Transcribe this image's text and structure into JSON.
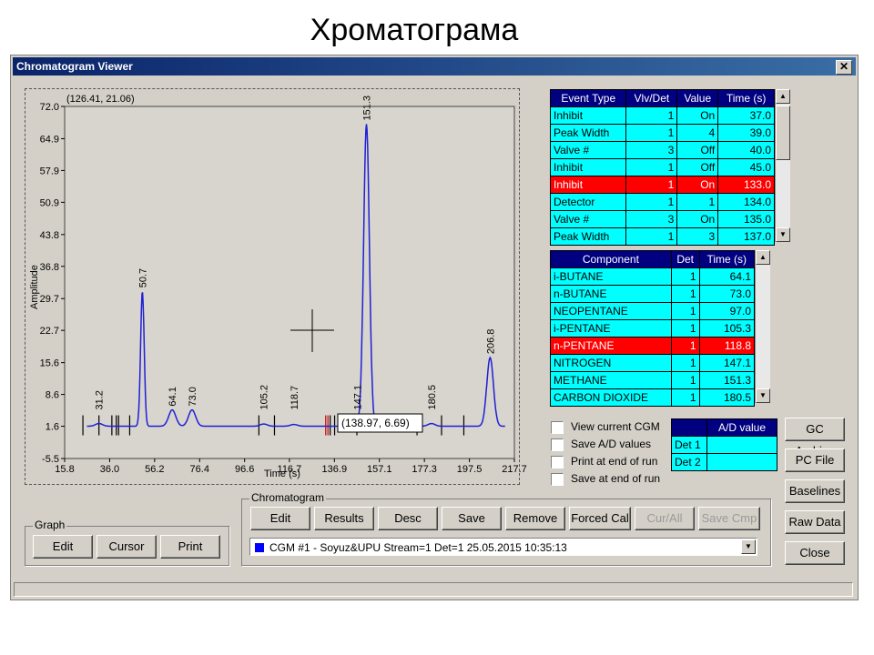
{
  "slide_title": "Хроматограма",
  "window": {
    "title": "Chromatogram Viewer",
    "close_glyph": "✕"
  },
  "graph": {
    "coord_readout": "(126.41, 21.06)",
    "cursor_readout": "(138.97, 6.69)",
    "ylabel": "Amplitude",
    "xlabel": "Time (s)",
    "y_ticks": [
      "72.0",
      "64.9",
      "57.9",
      "50.9",
      "43.8",
      "36.8",
      "29.7",
      "22.7",
      "15.6",
      "8.6",
      "1.6",
      "-5.5"
    ],
    "x_ticks": [
      "15.8",
      "36.0",
      "56.2",
      "76.4",
      "96.6",
      "116.7",
      "136.9",
      "157.1",
      "177.3",
      "197.5",
      "217.7"
    ],
    "peak_labels": [
      "31.2",
      "50.7",
      "64.1",
      "73.0",
      "105.2",
      "118.7",
      "147.1",
      "151.3",
      "180.5",
      "206.8"
    ]
  },
  "chart_data": {
    "type": "line",
    "title": "",
    "xlabel": "Time (s)",
    "ylabel": "Amplitude",
    "xlim": [
      15.8,
      217.7
    ],
    "ylim": [
      -5.5,
      72.0
    ],
    "baseline": 1.6,
    "peaks": [
      {
        "t": 31.2,
        "height": 0.6
      },
      {
        "t": 50.7,
        "height": 29.7
      },
      {
        "t": 64.1,
        "height": 3.6
      },
      {
        "t": 73.0,
        "height": 3.6
      },
      {
        "t": 105.2,
        "height": 0.5
      },
      {
        "t": 118.7,
        "height": 0.4
      },
      {
        "t": 147.1,
        "height": 0.5
      },
      {
        "t": 151.3,
        "height": 66.5
      },
      {
        "t": 180.5,
        "height": 0.6
      },
      {
        "t": 206.8,
        "height": 15.1
      }
    ],
    "series_color": "#1f1fd6"
  },
  "events": {
    "headers": [
      "Event Type",
      "Vlv/Det",
      "Value",
      "Time (s)"
    ],
    "rows": [
      [
        "Inhibit",
        "1",
        "On",
        "37.0"
      ],
      [
        "Peak Width",
        "1",
        "4",
        "39.0"
      ],
      [
        "Valve #",
        "3",
        "Off",
        "40.0"
      ],
      [
        "Inhibit",
        "1",
        "Off",
        "45.0"
      ],
      [
        "Inhibit",
        "1",
        "On",
        "133.0"
      ],
      [
        "Detector",
        "1",
        "1",
        "134.0"
      ],
      [
        "Valve #",
        "3",
        "On",
        "135.0"
      ],
      [
        "Peak Width",
        "1",
        "3",
        "137.0"
      ]
    ],
    "selected_index": 4
  },
  "components": {
    "headers": [
      "Component",
      "Det",
      "Time (s)"
    ],
    "rows": [
      [
        "i-BUTANE",
        "1",
        "64.1"
      ],
      [
        "n-BUTANE",
        "1",
        "73.0"
      ],
      [
        "NEOPENTANE",
        "1",
        "97.0"
      ],
      [
        "i-PENTANE",
        "1",
        "105.3"
      ],
      [
        "n-PENTANE",
        "1",
        "118.8"
      ],
      [
        "NITROGEN",
        "1",
        "147.1"
      ],
      [
        "METHANE",
        "1",
        "151.3"
      ],
      [
        "CARBON DIOXIDE",
        "1",
        "180.5"
      ]
    ],
    "selected_index": 4
  },
  "options": {
    "view_current": "View current CGM",
    "save_ad": "Save A/D values",
    "print_end": "Print at end of run",
    "save_end": "Save at end of run"
  },
  "ad_table": {
    "header": "A/D value",
    "rows": [
      "Det 1",
      "Det 2"
    ]
  },
  "side_buttons": {
    "gc_archive": "GC Archive",
    "pc_file": "PC File",
    "baselines": "Baselines",
    "raw_data": "Raw Data",
    "close": "Close"
  },
  "chromatogram_group": {
    "label": "Chromatogram",
    "edit": "Edit",
    "results": "Results",
    "desc": "Desc",
    "save": "Save",
    "remove": "Remove",
    "forced_cal": "Forced Cal",
    "cur_all": "Cur/All",
    "save_cmp": "Save Cmp",
    "selected_cgm": "CGM #1 - Soyuz&UPU Stream=1 Det=1 25.05.2015 10:35:13",
    "cgm_color": "#0000ff"
  },
  "graph_group": {
    "label": "Graph",
    "edit": "Edit",
    "cursor": "Cursor",
    "print": "Print"
  }
}
